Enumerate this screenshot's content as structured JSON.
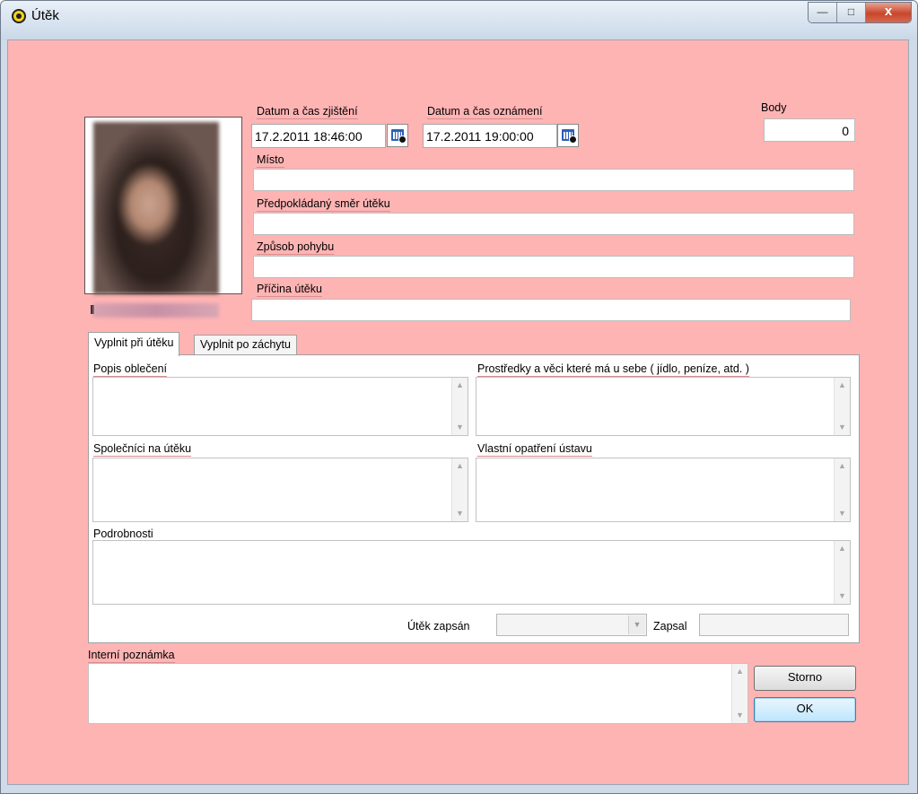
{
  "window": {
    "title": "Útěk",
    "minimize": "—",
    "maximize": "□",
    "close": "x"
  },
  "fields": {
    "datum_zjisteni_label": "Datum a čas zjištění",
    "datum_zjisteni_value": "17.2.2011 18:46:00",
    "datum_oznameni_label": "Datum a čas oznámení",
    "datum_oznameni_value": "17.2.2011 19:00:00",
    "body_label": "Body",
    "body_value": "0",
    "misto_label": "Místo",
    "smer_label": "Předpokládaný směr útěku",
    "zpusob_label": "Způsob pohybu",
    "pricina_label": "Příčina útěku"
  },
  "tabs": {
    "tab1": "Vyplnit při útěku",
    "tab2": "Vyplnit po záchytu"
  },
  "panel": {
    "popis_label": "Popis oblečení",
    "prostredky_label": "Prostředky a věci které má u sebe ( jídlo, peníze, atd. )",
    "spolecnici_label": "Společníci na útěku",
    "opatreni_label": "Vlastní opatření ústavu",
    "podrobnosti_label": "Podrobnosti",
    "zapsan_label": "Útěk zapsán",
    "zapsal_label": "Zapsal"
  },
  "interni_label": "Interní poznámka",
  "buttons": {
    "storno": "Storno",
    "ok": "OK"
  },
  "icons": {
    "scroll_up": "▲",
    "scroll_down": "▼",
    "combo_arrow": "▼"
  },
  "colors": {
    "client_bg": "#ffb4b4",
    "titlebar": "#d6e2ef",
    "close_btn": "#c8462c"
  }
}
